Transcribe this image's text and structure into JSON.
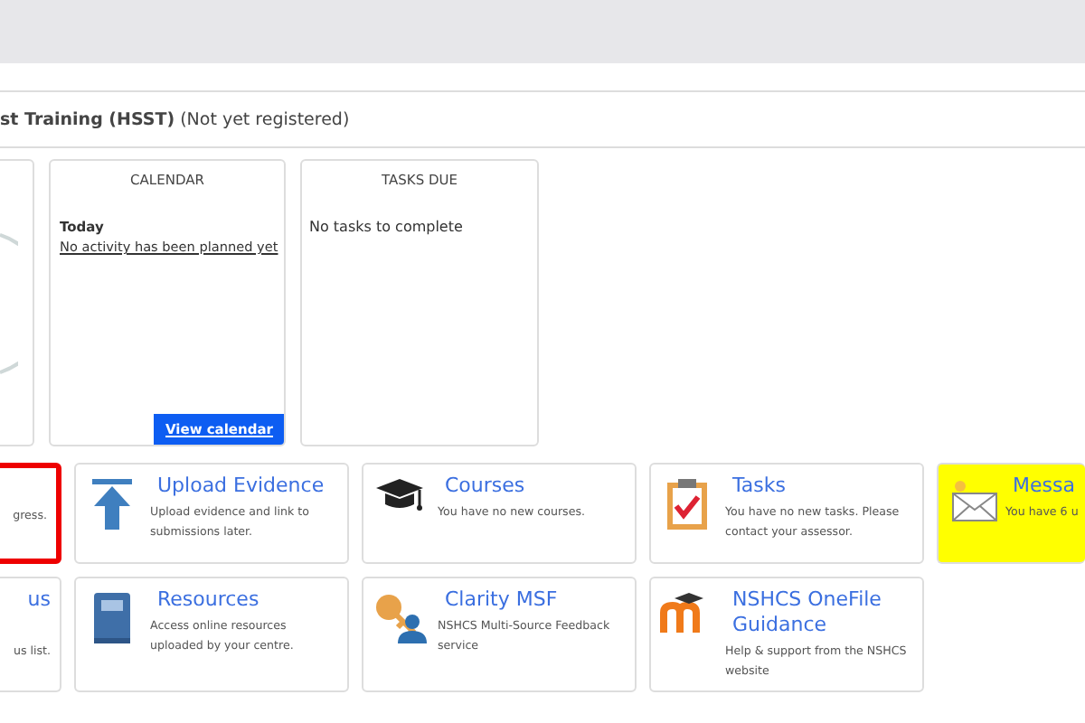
{
  "header": {
    "title_bold": "st Training (HSST)",
    "title_rest": "(Not yet registered)"
  },
  "panels": [
    {
      "kind": "partial"
    },
    {
      "kind": "calendar",
      "heading": "CALENDAR",
      "day": "Today",
      "entry": "No activity has been planned yet",
      "button": "View calendar"
    },
    {
      "kind": "tasks",
      "heading": "TASKS DUE",
      "text": "No tasks to complete"
    }
  ],
  "tiles": [
    {
      "kind": "partial",
      "text": "gress.",
      "selected": true,
      "highlighted": false
    },
    {
      "kind": "upload",
      "title": "Upload Evidence",
      "text": "Upload evidence and link to submissions later.",
      "selected": false,
      "highlighted": false
    },
    {
      "kind": "courses",
      "title": "Courses",
      "text": "You have no new courses.",
      "selected": false,
      "highlighted": false
    },
    {
      "kind": "tasks",
      "title": "Tasks",
      "text": "You have no new tasks. Please contact your assessor.",
      "selected": false,
      "highlighted": false
    },
    {
      "kind": "messages",
      "title": "Messa",
      "text": "You have 6 u",
      "selected": false,
      "highlighted": true
    },
    {
      "kind": "partial",
      "title": "us",
      "text": "us list.",
      "selected": false,
      "highlighted": false
    },
    {
      "kind": "resources",
      "title": "Resources",
      "text": "Access online resources uploaded by your centre.",
      "selected": false,
      "highlighted": false
    },
    {
      "kind": "msf",
      "title": "Clarity MSF",
      "text": "NSHCS Multi-Source Feedback service",
      "selected": false,
      "highlighted": false
    },
    {
      "kind": "guidance",
      "title": "NSHCS OneFile Guidance",
      "text": "Help & support from the NSHCS website",
      "selected": false,
      "highlighted": false
    }
  ]
}
